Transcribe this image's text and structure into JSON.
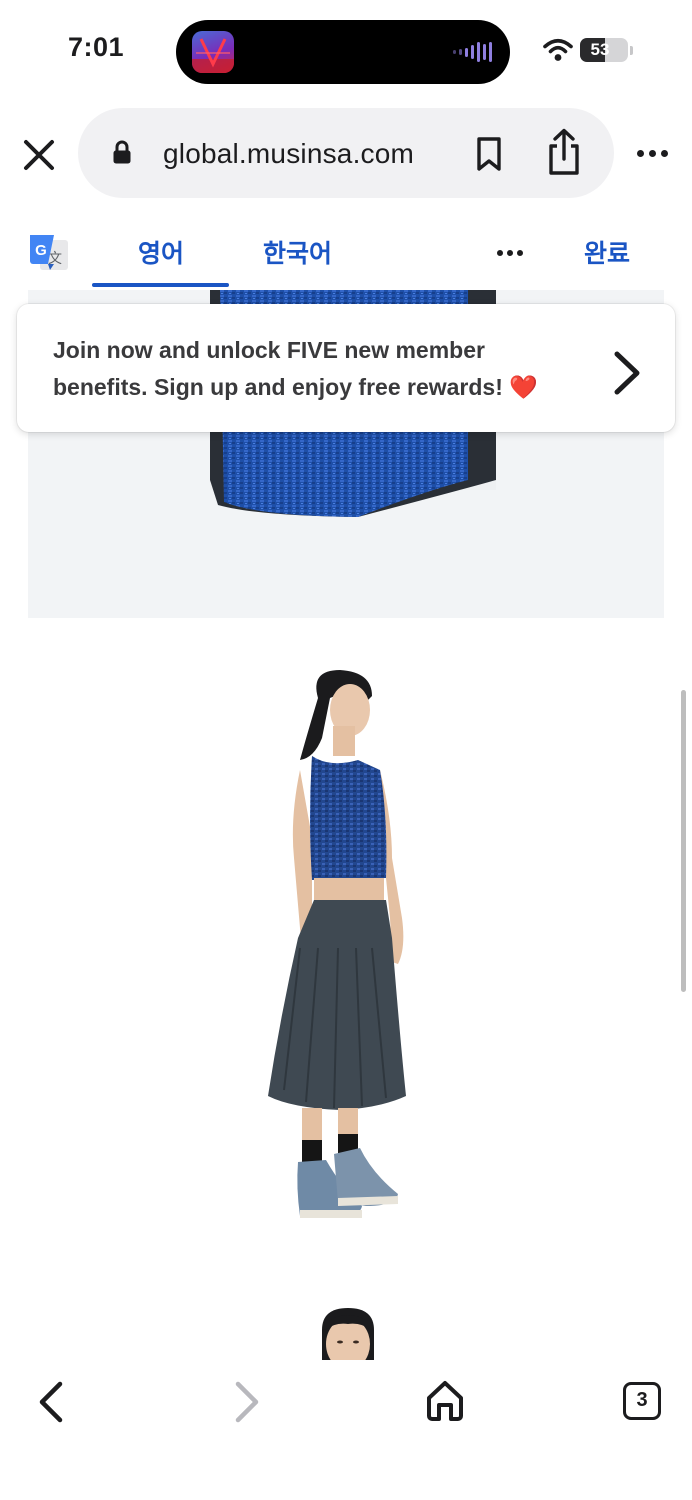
{
  "status_bar": {
    "time": "7:01",
    "battery_level": "53",
    "battery_fraction": 0.53,
    "live_activity_icon": "v-app-icon",
    "audio_icon": "sound-wave-icon"
  },
  "browser": {
    "url": "global.musinsa.com",
    "close_icon": "close-icon",
    "lock_icon": "lock-icon",
    "bookmark_icon": "bookmark-icon",
    "share_icon": "share-icon",
    "more_icon": "more-horizontal-icon"
  },
  "translate_bar": {
    "logo_icon": "google-translate-icon",
    "tabs": [
      {
        "label": "영어",
        "active": true
      },
      {
        "label": "한국어",
        "active": false
      }
    ],
    "more_icon": "more-horizontal-icon",
    "done_label": "완료",
    "accent_color": "#1a55c4"
  },
  "promo": {
    "line1": "Join now and unlock FIVE new member",
    "line2": "benefits. Sign up and enjoy free rewards! ❤️",
    "arrow_icon": "chevron-right-icon"
  },
  "product_images": [
    {
      "name": "top-detail-photo"
    },
    {
      "name": "model-full-outfit-photo"
    },
    {
      "name": "model-closeup-photo"
    }
  ],
  "toolbar": {
    "back_icon": "chevron-left-icon",
    "forward_icon": "chevron-right-icon",
    "home_icon": "home-icon",
    "tabs_count": "3"
  }
}
